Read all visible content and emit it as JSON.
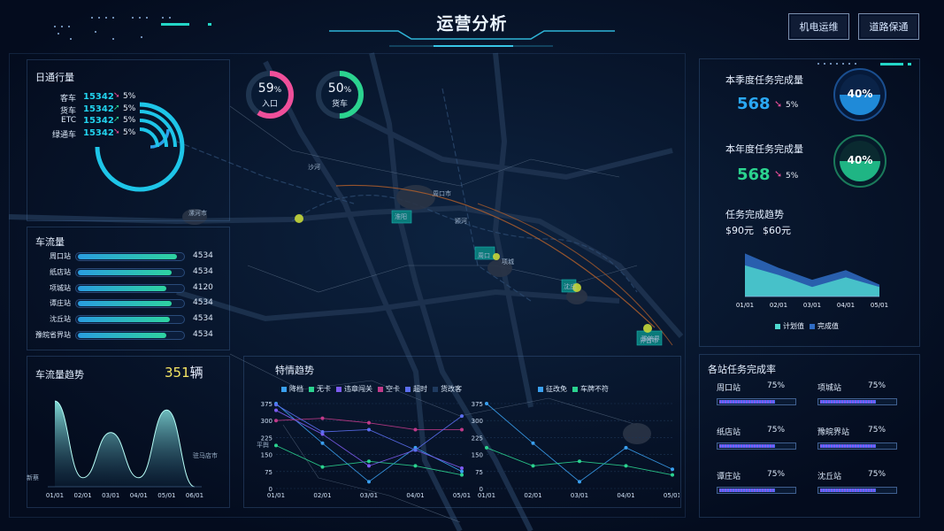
{
  "header": {
    "title": "运营分析",
    "btn_left": "机电运维",
    "btn_right": "道路保通"
  },
  "daily_traffic": {
    "title": "日通行量",
    "rows": [
      {
        "label": "客车",
        "value": "15342",
        "pct": "5%",
        "trend": "down"
      },
      {
        "label": "货车",
        "value": "15342",
        "pct": "5%",
        "trend": "up"
      },
      {
        "label": "ETC",
        "value": "15342",
        "pct": "5%",
        "trend": "up"
      },
      {
        "label": "绿通车",
        "value": "15342",
        "pct": "5%",
        "trend": "down"
      }
    ]
  },
  "rings": [
    {
      "value": "59",
      "unit": "%",
      "label": "入口",
      "level": 0.59,
      "color": "#ef4f9a"
    },
    {
      "value": "50",
      "unit": "%",
      "label": "货车",
      "level": 0.5,
      "color": "#2bd38f"
    }
  ],
  "flow": {
    "title": "车流量",
    "stations": [
      {
        "name": "周口站",
        "value": "4534",
        "level": 0.95
      },
      {
        "name": "纸店站",
        "value": "4534",
        "level": 0.9
      },
      {
        "name": "项城站",
        "value": "4120",
        "level": 0.85
      },
      {
        "name": "谭庄站",
        "value": "4534",
        "level": 0.9
      },
      {
        "name": "沈丘站",
        "value": "4534",
        "level": 0.88
      },
      {
        "name": "豫皖省界站",
        "value": "4534",
        "level": 0.85
      }
    ]
  },
  "flow_trend": {
    "title": "车流量趋势",
    "total": "351",
    "unit": "辆"
  },
  "special": {
    "title": "特情趋势",
    "legend_left": [
      "降档",
      "无卡",
      "违章闯关",
      "空卡",
      "超时",
      "货改客"
    ],
    "legend_right": [
      "征改免",
      "车牌不符"
    ]
  },
  "quarter": {
    "title": "本季度任务完成量",
    "value": "568",
    "pct": "5%",
    "gauge": "40%"
  },
  "year": {
    "title": "本年度任务完成量",
    "value": "568",
    "pct": "5%",
    "gauge": "40%"
  },
  "task_trend": {
    "title": "任务完成趋势",
    "val1": "$90元",
    "val2": "$60元",
    "legend": [
      "计划值",
      "完成值"
    ]
  },
  "station_rate": {
    "title": "各站任务完成率",
    "items": [
      {
        "name": "周口站",
        "pct": "75%",
        "level": 0.75
      },
      {
        "name": "项城站",
        "pct": "75%",
        "level": 0.75
      },
      {
        "name": "纸店站",
        "pct": "75%",
        "level": 0.75
      },
      {
        "name": "豫皖界站",
        "pct": "75%",
        "level": 0.75
      },
      {
        "name": "谭庄站",
        "pct": "75%",
        "level": 0.75
      },
      {
        "name": "沈丘站",
        "pct": "75%",
        "level": 0.75
      }
    ]
  },
  "map_labels": [
    "漯河市",
    "周口市",
    "沙河",
    "颍河",
    "淮阳",
    "周口",
    "项城",
    "沈丘",
    "界首市",
    "豫皖界",
    "驻马店市",
    "平舆",
    "新蔡"
  ],
  "colors": {
    "accent": "#22d3ee",
    "pink": "#ef4f9a",
    "green": "#2bd38f",
    "up": "#2bd38f",
    "down": "#ef4f9a"
  },
  "chart_data": [
    {
      "type": "area",
      "title": "车流量趋势",
      "categories": [
        "01/01",
        "02/01",
        "03/01",
        "04/01",
        "05/01",
        "06/01"
      ],
      "values": [
        95,
        10,
        60,
        10,
        85,
        0
      ]
    },
    {
      "type": "line",
      "title": "特情趋势",
      "categories": [
        "01/01",
        "02/01",
        "03/01",
        "04/01",
        "05/01"
      ],
      "yticks": [
        0,
        75,
        150,
        225,
        300,
        375
      ],
      "ylim": [
        0,
        375
      ],
      "series": [
        {
          "name": "降档",
          "color": "#3aa0f0",
          "values": [
            375,
            200,
            30,
            180,
            75
          ]
        },
        {
          "name": "无卡",
          "color": "#2bd38f",
          "values": [
            190,
            95,
            120,
            100,
            60
          ]
        },
        {
          "name": "违章闯关",
          "color": "#7c5cf0",
          "values": [
            345,
            240,
            100,
            170,
            90
          ]
        },
        {
          "name": "空卡",
          "color": "#c03a8a",
          "values": [
            300,
            310,
            290,
            260,
            260
          ]
        },
        {
          "name": "超时",
          "color": "#5b6ef0",
          "values": [
            370,
            250,
            260,
            170,
            320
          ]
        }
      ]
    },
    {
      "type": "line",
      "title": "特情趋势",
      "categories": [
        "01/01",
        "02/01",
        "03/01",
        "04/01",
        "05/01"
      ],
      "yticks": [
        0,
        75,
        150,
        225,
        300,
        375
      ],
      "ylim": [
        0,
        375
      ],
      "series": [
        {
          "name": "征改免",
          "color": "#3aa0f0",
          "values": [
            375,
            200,
            30,
            180,
            85
          ]
        },
        {
          "name": "车牌不符",
          "color": "#2bd38f",
          "values": [
            180,
            100,
            120,
            100,
            60
          ]
        }
      ]
    },
    {
      "type": "area",
      "title": "任务完成趋势",
      "categories": [
        "01/01",
        "02/01",
        "03/01",
        "04/01",
        "05/01"
      ],
      "series": [
        {
          "name": "计划值",
          "values": [
            65,
            45,
            20,
            40,
            20
          ]
        },
        {
          "name": "完成值",
          "values": [
            90,
            60,
            35,
            55,
            25
          ]
        }
      ]
    }
  ]
}
